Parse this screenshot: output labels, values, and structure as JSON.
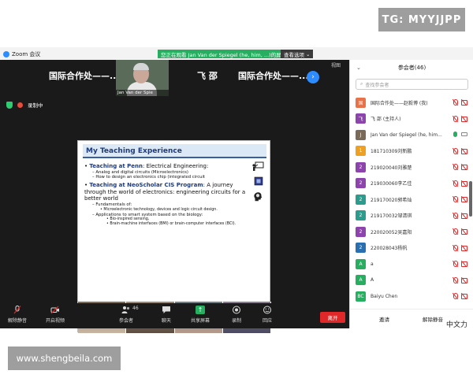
{
  "watermarks": {
    "tg": "TG: MYYJJPP",
    "site": "www.shengbeila.com"
  },
  "window": {
    "app_title": "Zoom 会议",
    "view_banner": "您正在观看 Jan Van der Spiegel (he, him, ...)的屏幕",
    "view_options": "查看选项",
    "gallery_label": "视图"
  },
  "strip": {
    "tile_left": "国际合作处——...",
    "video_name": "Jan Van der Spie",
    "tile_mid": "飞 邵",
    "tile_right": "国际合作处——..."
  },
  "status": {
    "recording": "录制中"
  },
  "slide": {
    "title": "My Teaching Experience",
    "bullet1_hl": "Teaching at Penn",
    "bullet1_rest": ": Electrical Engineering:",
    "sub1": "– Analog and digital circuits (Microelectronics)",
    "sub2": "– How to design an electronics chip (integrated circuit",
    "bullet2_hl": "Teaching at NeoScholar CIS Program",
    "bullet2_rest": ": A journey through the world of electronics: engineering circuits for a better world",
    "sub3": "– Fundamentals of:",
    "sub3a": "• Microelectronic technology, devices and logic circuit design.",
    "sub4": "– Applications to smart system based on the biology:",
    "sub4a": "• Bio-inspired sensing,",
    "sub4b": "• Brain-machine interfaces (BMI) or brain-computer interfaces (BCI)."
  },
  "toolbar": {
    "mute": "解除静音",
    "video": "开启视频",
    "participants": "参会者",
    "participants_count": "46",
    "chat": "聊天",
    "share": "共享屏幕",
    "record": "录制",
    "reactions": "回应",
    "end": "离开"
  },
  "panel": {
    "title": "参会者(46)",
    "search_placeholder": "查找参会者",
    "participants": [
      {
        "avatar": "国",
        "color": "#e8734a",
        "name": "国际合作处——赵毅博 (我)",
        "mic": "off",
        "cam": "off"
      },
      {
        "avatar": "飞",
        "color": "#8e44ad",
        "name": "飞 邵 (主持人)",
        "mic": "off",
        "cam": "off"
      },
      {
        "avatar": "J",
        "color": "#7a6a5a",
        "name": "Jan Van der Spiegel (he, him...",
        "mic": "on",
        "cam": "on"
      },
      {
        "avatar": "1",
        "color": "#f0a020",
        "name": "181710309刘新鹏",
        "mic": "off",
        "cam": "off"
      },
      {
        "avatar": "2",
        "color": "#8e44ad",
        "name": "219020040刘雅楚",
        "mic": "off",
        "cam": "off"
      },
      {
        "avatar": "2",
        "color": "#8e44ad",
        "name": "219030060李乙佳",
        "mic": "off",
        "cam": "off"
      },
      {
        "avatar": "2",
        "color": "#2a9d8f",
        "name": "219170020郭希灿",
        "mic": "off",
        "cam": "off"
      },
      {
        "avatar": "2",
        "color": "#2a9d8f",
        "name": "219170032邹清琪",
        "mic": "off",
        "cam": "off"
      },
      {
        "avatar": "2",
        "color": "#8e44ad",
        "name": "220020052吴嘉阳",
        "mic": "off",
        "cam": "off"
      },
      {
        "avatar": "2",
        "color": "#2a6fb0",
        "name": "220028043杨帆",
        "mic": "off",
        "cam": "off"
      },
      {
        "avatar": "A",
        "color": "#27ae60",
        "name": "a",
        "mic": "off",
        "cam": "off"
      },
      {
        "avatar": "A",
        "color": "#27ae60",
        "name": "A",
        "mic": "off",
        "cam": "off"
      },
      {
        "avatar": "BC",
        "color": "#27ae60",
        "name": "Baiyu Chen",
        "mic": "off",
        "cam": "off"
      }
    ],
    "invite": "邀请",
    "mute_all": "解除静音",
    "corner": "中文力"
  }
}
